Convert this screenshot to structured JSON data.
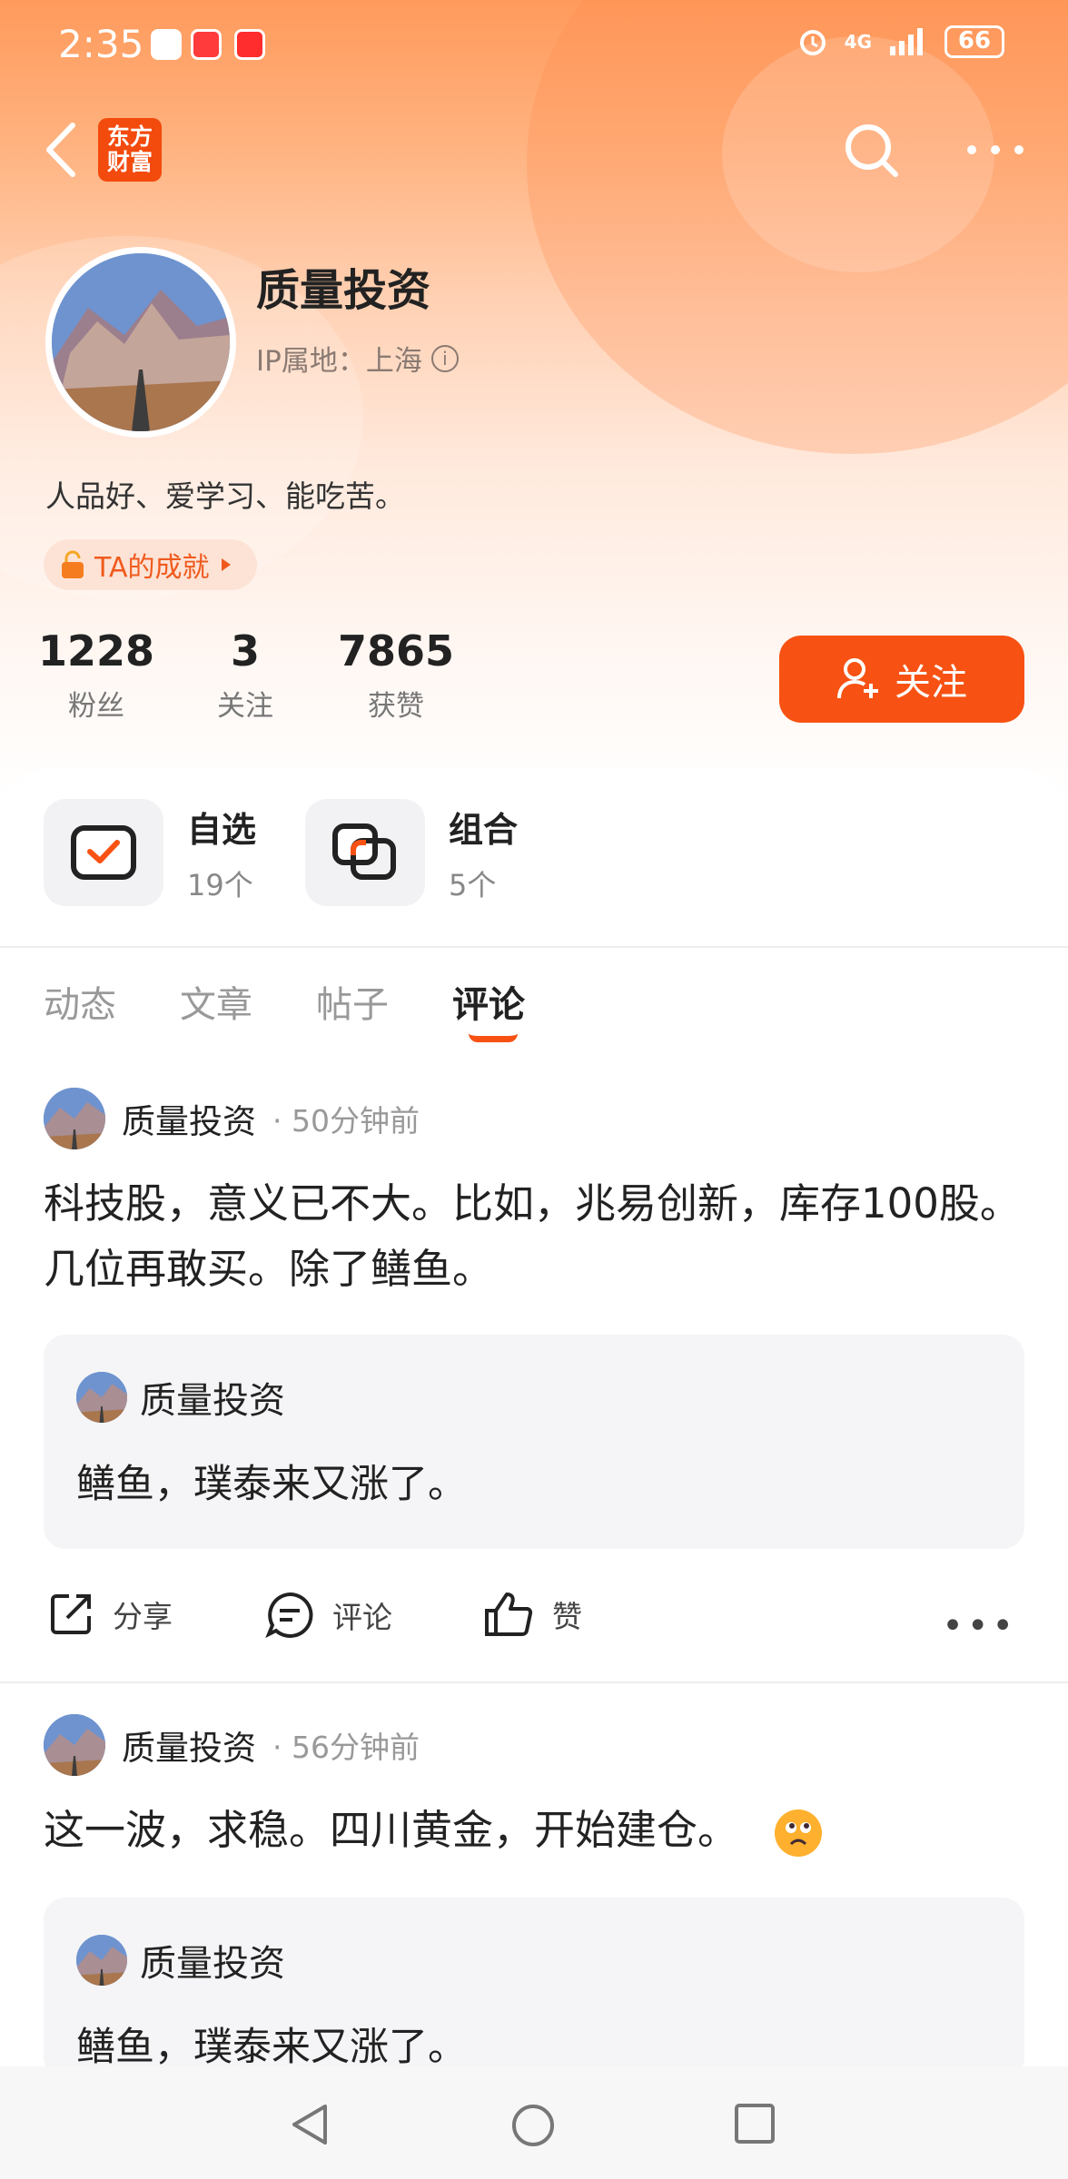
{
  "status_bar": {
    "time": "2:35",
    "network": "4G",
    "battery": "66"
  },
  "header": {
    "logo_text": "东方财富"
  },
  "profile": {
    "name": "质量投资",
    "ip_location": "IP属地：上海",
    "bio": "人品好、爱学习、能吃苦。",
    "achievement_label": "TA的成就",
    "stats": [
      {
        "value": "1228",
        "label": "粉丝"
      },
      {
        "value": "3",
        "label": "关注"
      },
      {
        "value": "7865",
        "label": "获赞"
      }
    ],
    "follow_label": "关注"
  },
  "quick_cards": [
    {
      "title": "自选",
      "subtitle": "19个"
    },
    {
      "title": "组合",
      "subtitle": "5个"
    }
  ],
  "tabs": [
    {
      "label": "动态",
      "active": false
    },
    {
      "label": "文章",
      "active": false
    },
    {
      "label": "帖子",
      "active": false
    },
    {
      "label": "评论",
      "active": true
    }
  ],
  "posts": [
    {
      "author": "质量投资",
      "time": "· 50分钟前",
      "text": "科技股，意义已不大。比如，兆易创新，库存100股。几位再敢买。除了鳝鱼。",
      "quote": {
        "author": "质量投资",
        "text": "鳝鱼，璞泰来又涨了。"
      },
      "actions": {
        "share": "分享",
        "comment": "评论",
        "like": "赞"
      }
    },
    {
      "author": "质量投资",
      "time": "· 56分钟前",
      "text": "这一波，求稳。四川黄金，开始建仓。",
      "quote": {
        "author": "质量投资",
        "text": "鳝鱼，璞泰来又涨了。"
      }
    }
  ],
  "colors": {
    "accent": "#f75213",
    "hero_top": "#ff9a5c"
  }
}
